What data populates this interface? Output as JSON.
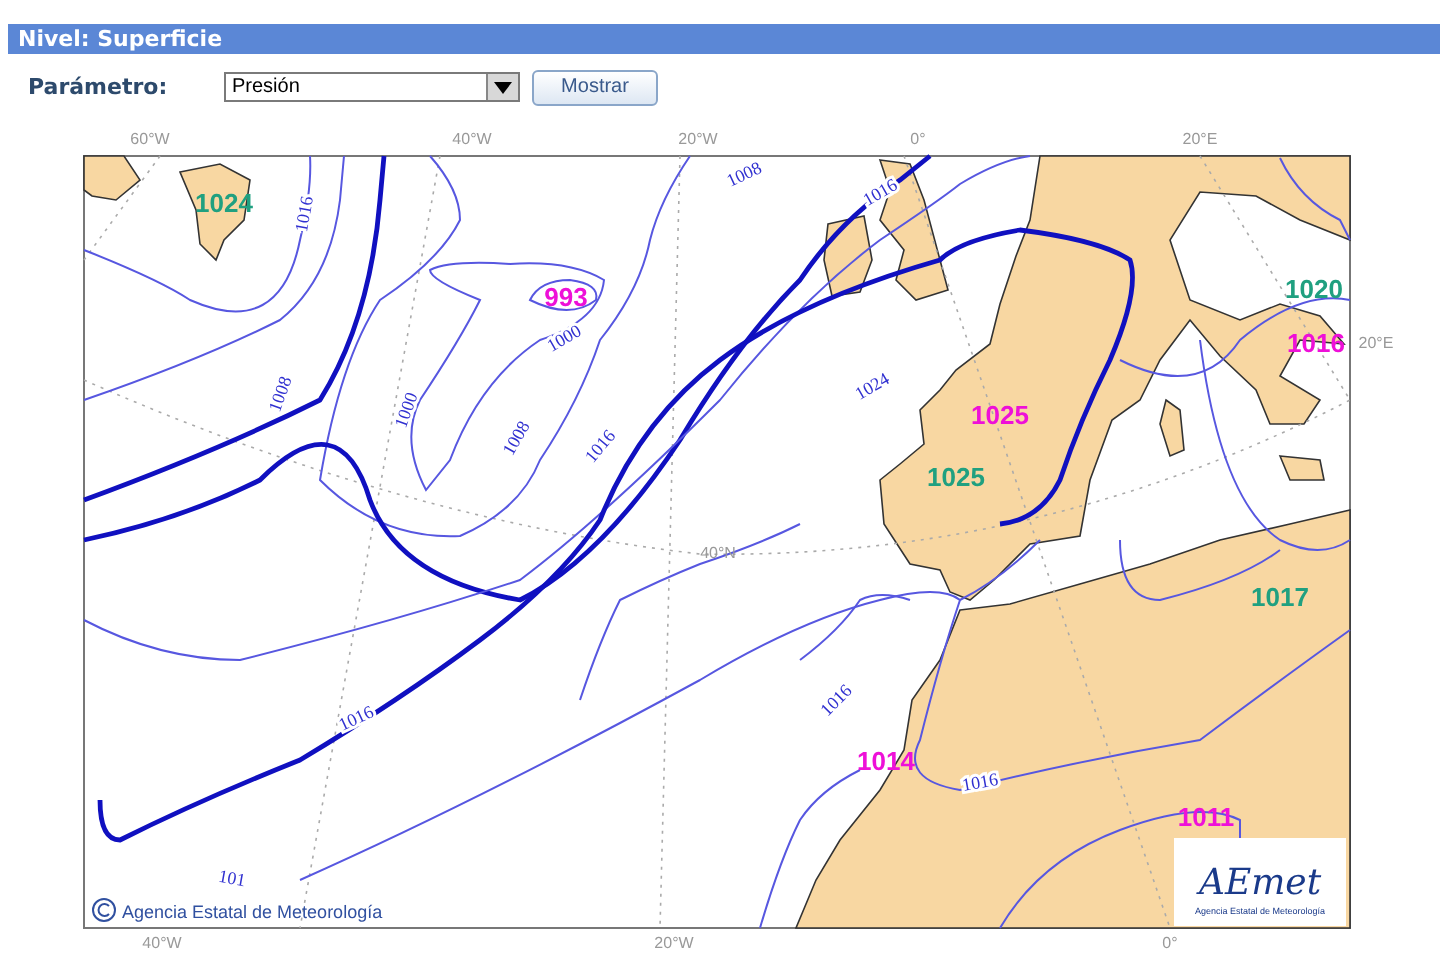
{
  "header": {
    "title": "Nivel: Superficie"
  },
  "controls": {
    "label": "Parámetro:",
    "select": {
      "value": "Presión"
    },
    "button": "Mostrar"
  },
  "map": {
    "axis_labels": [
      "60°W",
      "40°W",
      "20°W",
      "0°",
      "20°E",
      "20°E",
      "40°N",
      "40°W",
      "20°W",
      "0°"
    ],
    "pressure_centers": [
      {
        "text": "1024",
        "kind": "high"
      },
      {
        "text": "993",
        "kind": "low"
      },
      {
        "text": "1025",
        "kind": "low"
      },
      {
        "text": "1025",
        "kind": "high"
      },
      {
        "text": "1020",
        "kind": "high"
      },
      {
        "text": "1016",
        "kind": "low"
      },
      {
        "text": "1017",
        "kind": "high"
      },
      {
        "text": "1014",
        "kind": "low"
      },
      {
        "text": "1011",
        "kind": "low"
      }
    ],
    "contour_labels": [
      "1016",
      "1008",
      "1000",
      "1000",
      "1008",
      "1016",
      "1008",
      "1016",
      "1024",
      "1016",
      "101",
      "1016",
      "1016"
    ],
    "copyright": "Agencia Estatal de Meteorología",
    "logo": {
      "name": "AEmet",
      "subtitle": "Agencia Estatal de Meteorología"
    }
  }
}
